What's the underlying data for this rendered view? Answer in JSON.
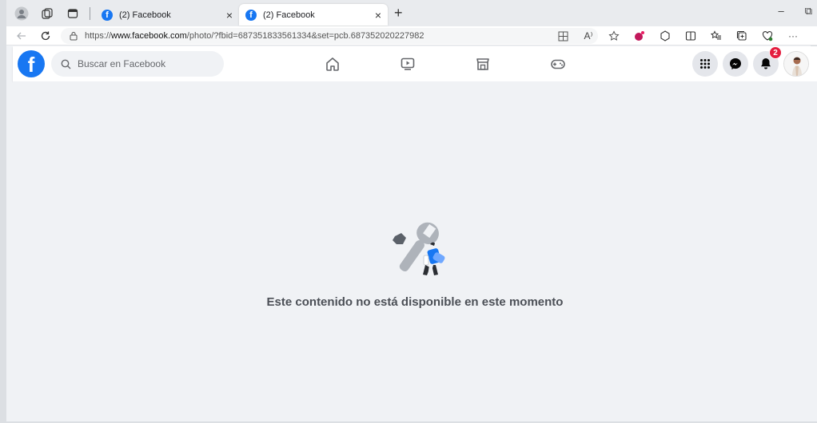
{
  "browser": {
    "tabs": [
      {
        "title": "(2) Facebook",
        "close": "×",
        "active": false
      },
      {
        "title": "(2) Facebook",
        "close": "×",
        "active": true
      }
    ],
    "new_tab": "+",
    "window_controls": {
      "minimize": "–",
      "restore": "⧉"
    },
    "url_prefix": "https://",
    "url_host": "www.facebook.com",
    "url_path": "/photo/?fbid=687351833561334&set=pcb.687352020227982",
    "read_aloud": "A⁾",
    "more": "···"
  },
  "facebook": {
    "logo": "f",
    "search_placeholder": "Buscar en Facebook",
    "notifications_count": "2"
  },
  "content": {
    "message": "Este contenido no está disponible en este momento"
  }
}
